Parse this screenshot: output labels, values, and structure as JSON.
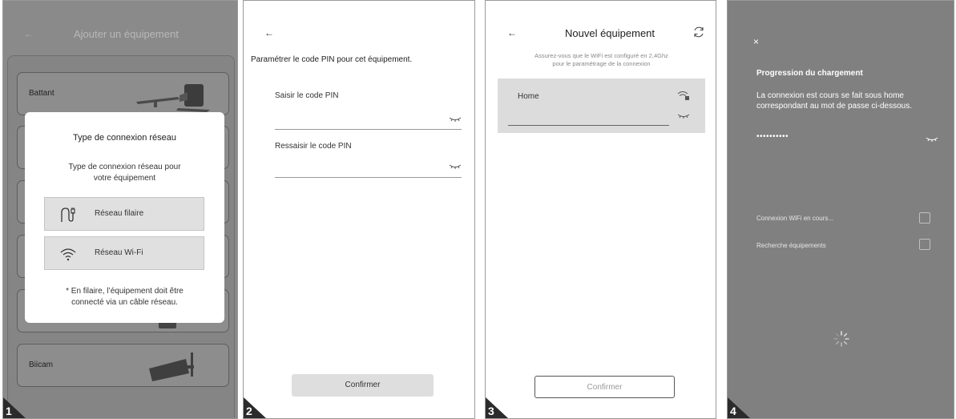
{
  "panel1": {
    "step": "1",
    "back_arrow": "←",
    "title": "Ajouter un équipement",
    "list": [
      {
        "label": "Battant"
      },
      {
        "label": "Biicam"
      }
    ],
    "modal": {
      "title": "Type de connexion réseau",
      "subtitle_line1": "Type de connexion réseau pour",
      "subtitle_line2": "votre équipement",
      "option_wired": "Réseau filaire",
      "option_wifi": "Réseau Wi-Fi",
      "note_line1": "* En filaire, l’équipement doit être",
      "note_line2": "connecté via un câble réseau."
    }
  },
  "panel2": {
    "step": "2",
    "back_arrow": "←",
    "heading": "Paramétrer le code PIN pour cet équipement.",
    "field1_label": "Saisir le code PIN",
    "field2_label": "Ressaisir le code PIN",
    "confirm": "Confirmer"
  },
  "panel3": {
    "step": "3",
    "back_arrow": "←",
    "title": "Nouvel équipement",
    "subtitle_line1": "Assurez-vous que le WiFi est configuré en 2,4Ghz",
    "subtitle_line2": "pour le paramétrage de la connexion",
    "network_name": "Home",
    "confirm": "Confirmer"
  },
  "panel4": {
    "step": "4",
    "close": "×",
    "heading": "Progression du chargement",
    "text_line1": "La connexion est cours se fait sous home",
    "text_line2": "correspondant au mot de passe ci-dessous.",
    "password": "••••••••••",
    "step1": "Connexion WiFi en cours...",
    "step2": "Recherche équipements"
  },
  "colors": {
    "overlay_grey": "#8a8a8a",
    "panel4_bg": "#808080",
    "button_grey": "#dedede"
  }
}
